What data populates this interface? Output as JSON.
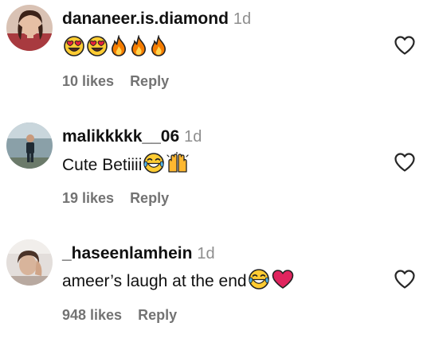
{
  "comments": [
    {
      "username": "dananeer.is.diamond",
      "time": "1d",
      "text": "",
      "emojis": [
        "heart-eyes-emoji",
        "heart-eyes-emoji",
        "fire-emoji",
        "fire-emoji",
        "fire-emoji"
      ],
      "likes": "10 likes",
      "reply": "Reply"
    },
    {
      "username": "malikkkkk__06",
      "time": "1d",
      "text": "Cute Betiiii",
      "emojis": [
        "laughing-tears-emoji",
        "raised-hands-emoji"
      ],
      "likes": "19 likes",
      "reply": "Reply"
    },
    {
      "username": "_haseenlamhein",
      "time": "1d",
      "text": "ameer’s laugh at the end",
      "emojis": [
        "laughing-tears-emoji",
        "red-heart-emoji"
      ],
      "likes": "948 likes",
      "reply": "Reply"
    }
  ],
  "icons": {
    "like": "heart-outline-icon"
  },
  "colors": {
    "text": "#111111",
    "secondary": "#737373",
    "timestamp": "#8e8e8e",
    "heart_outline": "#262626",
    "red_heart": "#e0245e"
  }
}
